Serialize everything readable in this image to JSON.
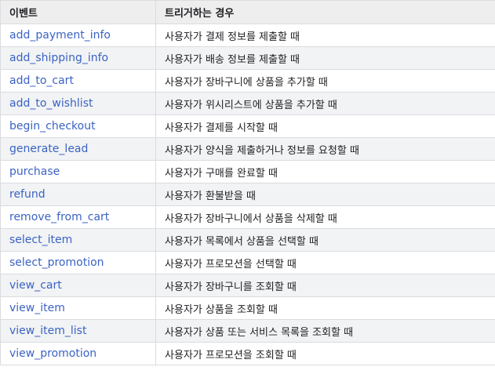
{
  "table": {
    "headers": {
      "event": "이벤트",
      "trigger": "트리거하는 경우"
    },
    "rows": [
      {
        "event": "add_payment_info",
        "trigger": "사용자가 결제 정보를 제출할 때"
      },
      {
        "event": "add_shipping_info",
        "trigger": "사용자가 배송 정보를 제출할 때"
      },
      {
        "event": "add_to_cart",
        "trigger": "사용자가 장바구니에 상품을 추가할 때"
      },
      {
        "event": "add_to_wishlist",
        "trigger": "사용자가 위시리스트에 상품을 추가할 때"
      },
      {
        "event": "begin_checkout",
        "trigger": "사용자가 결제를 시작할 때"
      },
      {
        "event": "generate_lead",
        "trigger": "사용자가 양식을 제출하거나 정보를 요청할 때"
      },
      {
        "event": "purchase",
        "trigger": "사용자가 구매를 완료할 때"
      },
      {
        "event": "refund",
        "trigger": "사용자가 환불받을 때"
      },
      {
        "event": "remove_from_cart",
        "trigger": "사용자가 장바구니에서 상품을 삭제할 때"
      },
      {
        "event": "select_item",
        "trigger": "사용자가 목록에서 상품을 선택할 때"
      },
      {
        "event": "select_promotion",
        "trigger": "사용자가 프로모션을 선택할 때"
      },
      {
        "event": "view_cart",
        "trigger": "사용자가 장바구니를 조회할 때"
      },
      {
        "event": "view_item",
        "trigger": "사용자가 상품을 조회할 때"
      },
      {
        "event": "view_item_list",
        "trigger": "사용자가 상품 또는 서비스 목록을 조회할 때"
      },
      {
        "event": "view_promotion",
        "trigger": "사용자가 프로모션을 조회할 때"
      }
    ]
  }
}
